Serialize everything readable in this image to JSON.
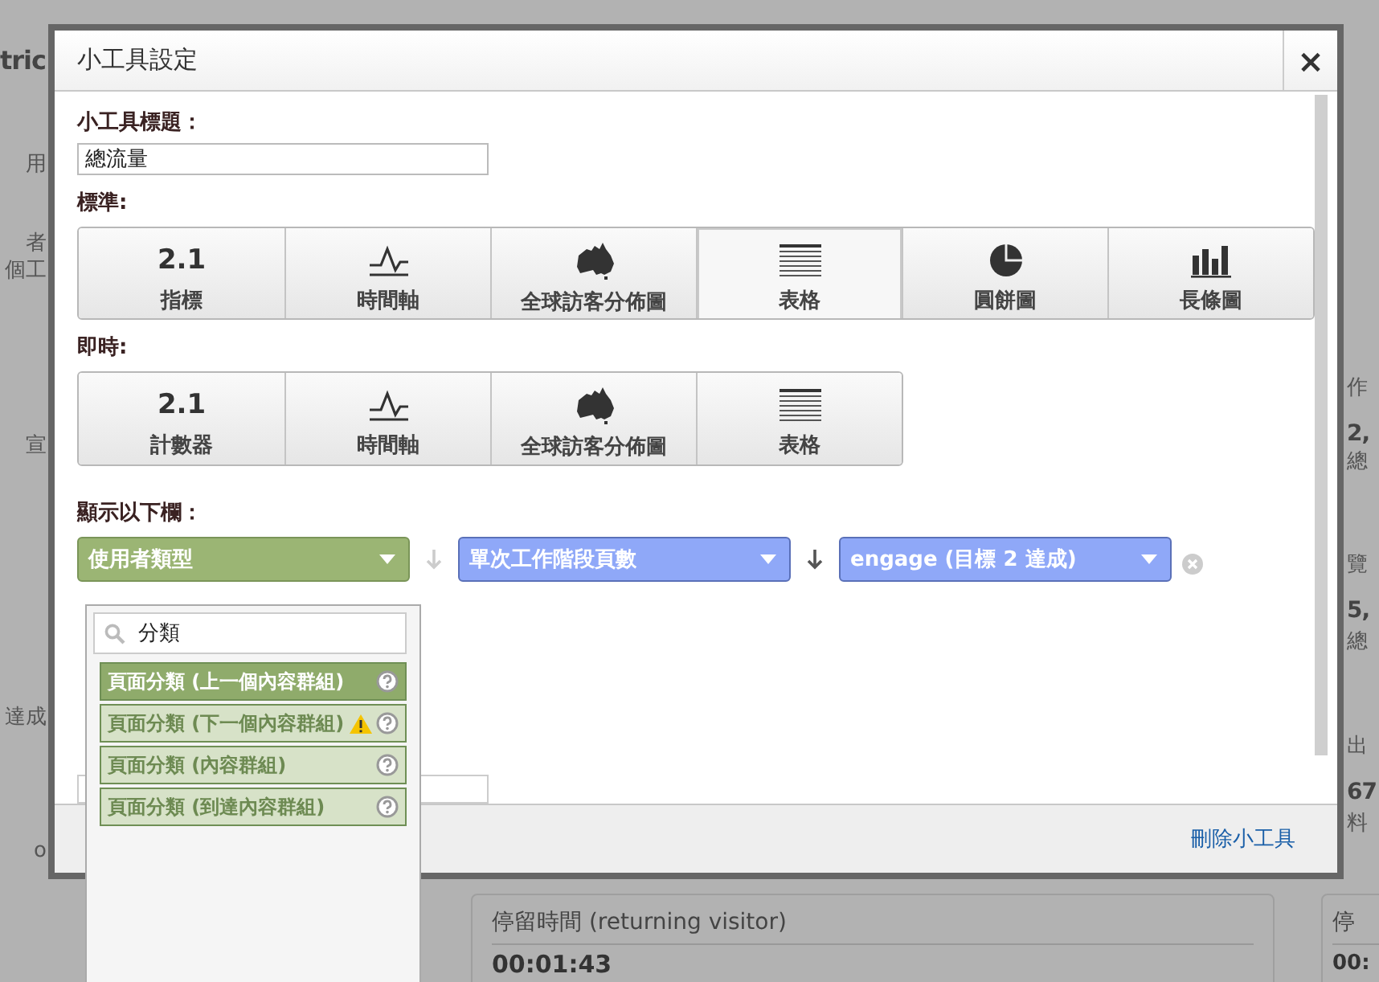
{
  "background_page": {
    "left_texts": [
      "tric",
      "用",
      "者",
      "個工",
      "宣",
      "達成",
      "o"
    ],
    "right_texts": [
      "作",
      "2,",
      "總",
      "覽",
      "5,",
      "總",
      "出",
      "67",
      "料"
    ],
    "cards": [
      {
        "title": "停留時間 (returning visitor)",
        "value": "00:01:43"
      },
      {
        "title": "停",
        "value": "00:"
      }
    ]
  },
  "dialog": {
    "title": "小工具設定",
    "close": "×",
    "title_label": "小工具標題：",
    "title_value": "總流量",
    "sections": [
      {
        "label": "標準:",
        "options": [
          {
            "kind": "metric",
            "figure": "2.1",
            "label": "指標",
            "selected": false
          },
          {
            "kind": "timeline",
            "label": "時間軸",
            "selected": false
          },
          {
            "kind": "map",
            "label": "全球訪客分佈圖",
            "selected": false
          },
          {
            "kind": "table",
            "label": "表格",
            "selected": true
          },
          {
            "kind": "pie",
            "label": "圓餅圖",
            "selected": false
          },
          {
            "kind": "bar",
            "label": "長條圖",
            "selected": false
          }
        ]
      },
      {
        "label": "即時:",
        "options": [
          {
            "kind": "metric",
            "figure": "2.1",
            "label": "計數器",
            "selected": false
          },
          {
            "kind": "timeline",
            "label": "時間軸",
            "selected": false
          },
          {
            "kind": "map",
            "label": "全球訪客分佈圖",
            "selected": false
          },
          {
            "kind": "table",
            "label": "表格",
            "selected": false
          }
        ]
      }
    ],
    "columns_label": "顯示以下欄：",
    "columns": [
      {
        "value": "使用者類型",
        "color": "#9bb574"
      },
      {
        "value": "單次工作階段頁數",
        "color": "#8fa8f8"
      },
      {
        "value": "engage (目標 2 達成)",
        "color": "#8fa8f8"
      }
    ],
    "dropdown": {
      "search": "分類",
      "items": [
        {
          "label": "頁面分類 (上一個內容群組)",
          "selected": true,
          "warning": false
        },
        {
          "label": "頁面分類 (下一個內容群組)",
          "selected": false,
          "warning": true
        },
        {
          "label": "頁面分類 (內容群組)",
          "selected": false,
          "warning": false
        },
        {
          "label": "頁面分類 (到達內容群組)",
          "selected": false,
          "warning": false
        }
      ]
    },
    "footer_link": "刪除小工具"
  }
}
